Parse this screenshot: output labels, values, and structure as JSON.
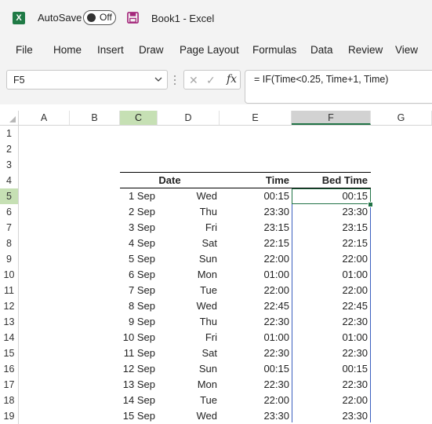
{
  "window": {
    "autosave_label": "AutoSave",
    "autosave_state": "Off",
    "title": "Book1  -  Excel",
    "app_icon_letter": "X"
  },
  "ribbon": {
    "tabs": [
      "File",
      "Home",
      "Insert",
      "Draw",
      "Page Layout",
      "Formulas",
      "Data",
      "Review",
      "View"
    ]
  },
  "formula_bar": {
    "name_box": "F5",
    "formula": "= IF(Time<0.25, Time+1, Time)",
    "fx_label": "fx"
  },
  "grid": {
    "columns": [
      "A",
      "B",
      "C",
      "D",
      "E",
      "F",
      "G"
    ],
    "highlighted_column": "C",
    "selected_column": "F",
    "rows": [
      "1",
      "2",
      "3",
      "4",
      "5",
      "6",
      "7",
      "8",
      "9",
      "10",
      "11",
      "12",
      "13",
      "14",
      "15",
      "16",
      "17",
      "18",
      "19"
    ],
    "highlighted_row": "5",
    "active_cell": "F5",
    "table_headers": {
      "date": "Date",
      "time": "Time",
      "bed_time": "Bed Time"
    },
    "table_rows": [
      {
        "date": "1 Sep",
        "day": "Wed",
        "time": "00:15",
        "bed_time": "00:15"
      },
      {
        "date": "2 Sep",
        "day": "Thu",
        "time": "23:30",
        "bed_time": "23:30"
      },
      {
        "date": "3 Sep",
        "day": "Fri",
        "time": "23:15",
        "bed_time": "23:15"
      },
      {
        "date": "4 Sep",
        "day": "Sat",
        "time": "22:15",
        "bed_time": "22:15"
      },
      {
        "date": "5 Sep",
        "day": "Sun",
        "time": "22:00",
        "bed_time": "22:00"
      },
      {
        "date": "6 Sep",
        "day": "Mon",
        "time": "01:00",
        "bed_time": "01:00"
      },
      {
        "date": "7 Sep",
        "day": "Tue",
        "time": "22:00",
        "bed_time": "22:00"
      },
      {
        "date": "8 Sep",
        "day": "Wed",
        "time": "22:45",
        "bed_time": "22:45"
      },
      {
        "date": "9 Sep",
        "day": "Thu",
        "time": "22:30",
        "bed_time": "22:30"
      },
      {
        "date": "10 Sep",
        "day": "Fri",
        "time": "01:00",
        "bed_time": "01:00"
      },
      {
        "date": "11 Sep",
        "day": "Sat",
        "time": "22:30",
        "bed_time": "22:30"
      },
      {
        "date": "12 Sep",
        "day": "Sun",
        "time": "00:15",
        "bed_time": "00:15"
      },
      {
        "date": "13 Sep",
        "day": "Mon",
        "time": "22:30",
        "bed_time": "22:30"
      },
      {
        "date": "14 Sep",
        "day": "Tue",
        "time": "22:00",
        "bed_time": "22:00"
      },
      {
        "date": "15 Sep",
        "day": "Wed",
        "time": "23:30",
        "bed_time": "23:30"
      }
    ]
  },
  "colors": {
    "excel_green": "#217346",
    "header_highlight": "#c6e0b4",
    "selection_border": "#3b5fbf",
    "save_icon": "#a4287b"
  }
}
